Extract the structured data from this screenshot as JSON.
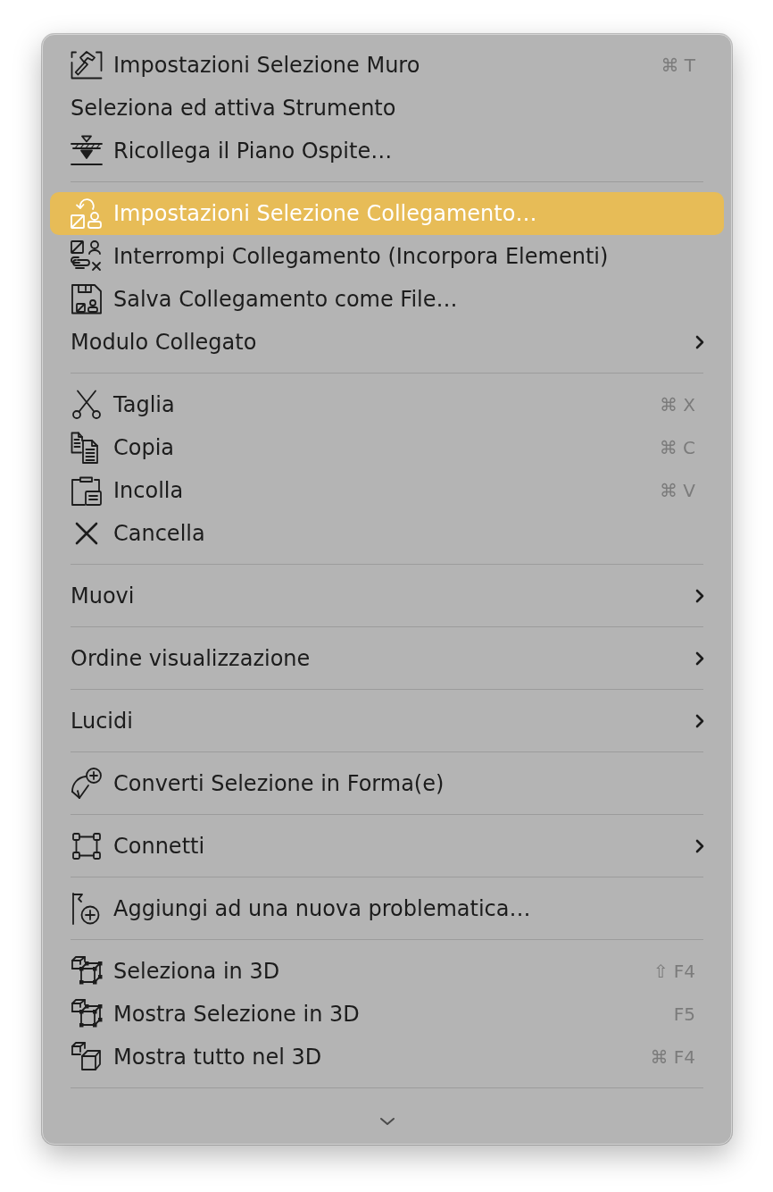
{
  "menu": {
    "sections": [
      {
        "items": [
          {
            "label": "Impostazioni Selezione Muro",
            "shortcut": "⌘ T",
            "selected": false,
            "submenu": false
          },
          {
            "label": "Seleziona ed attiva Strumento",
            "selected": false,
            "submenu": false
          },
          {
            "label": "Ricollega il Piano Ospite…",
            "selected": false,
            "submenu": false
          }
        ]
      },
      {
        "items": [
          {
            "label": "Impostazioni Selezione Collegamento…",
            "selected": true,
            "submenu": false
          },
          {
            "label": "Interrompi Collegamento (Incorpora Elementi)",
            "selected": false,
            "submenu": false
          },
          {
            "label": "Salva Collegamento come File…",
            "selected": false,
            "submenu": false
          },
          {
            "label": "Modulo Collegato",
            "selected": false,
            "submenu": true
          }
        ]
      },
      {
        "items": [
          {
            "label": "Taglia",
            "shortcut": "⌘ X",
            "selected": false,
            "submenu": false
          },
          {
            "label": "Copia",
            "shortcut": "⌘ C",
            "selected": false,
            "submenu": false
          },
          {
            "label": "Incolla",
            "shortcut": "⌘ V",
            "selected": false,
            "submenu": false
          },
          {
            "label": "Cancella",
            "selected": false,
            "submenu": false
          }
        ]
      },
      {
        "items": [
          {
            "label": "Muovi",
            "selected": false,
            "submenu": true
          }
        ]
      },
      {
        "items": [
          {
            "label": "Ordine visualizzazione",
            "selected": false,
            "submenu": true
          }
        ]
      },
      {
        "items": [
          {
            "label": "Lucidi",
            "selected": false,
            "submenu": true
          }
        ]
      },
      {
        "items": [
          {
            "label": "Converti Selezione in Forma(e)",
            "selected": false,
            "submenu": false
          }
        ]
      },
      {
        "items": [
          {
            "label": "Connetti",
            "selected": false,
            "submenu": true
          }
        ]
      },
      {
        "items": [
          {
            "label": "Aggiungi ad una nuova problematica…",
            "selected": false,
            "submenu": false
          }
        ]
      },
      {
        "items": [
          {
            "label": "Seleziona in 3D",
            "shortcut": "⇧ F4",
            "selected": false,
            "submenu": false
          },
          {
            "label": "Mostra Selezione in 3D",
            "shortcut": "F5",
            "selected": false,
            "submenu": false
          },
          {
            "label": "Mostra tutto nel 3D",
            "shortcut": "⌘ F4",
            "selected": false,
            "submenu": false
          }
        ]
      }
    ]
  }
}
